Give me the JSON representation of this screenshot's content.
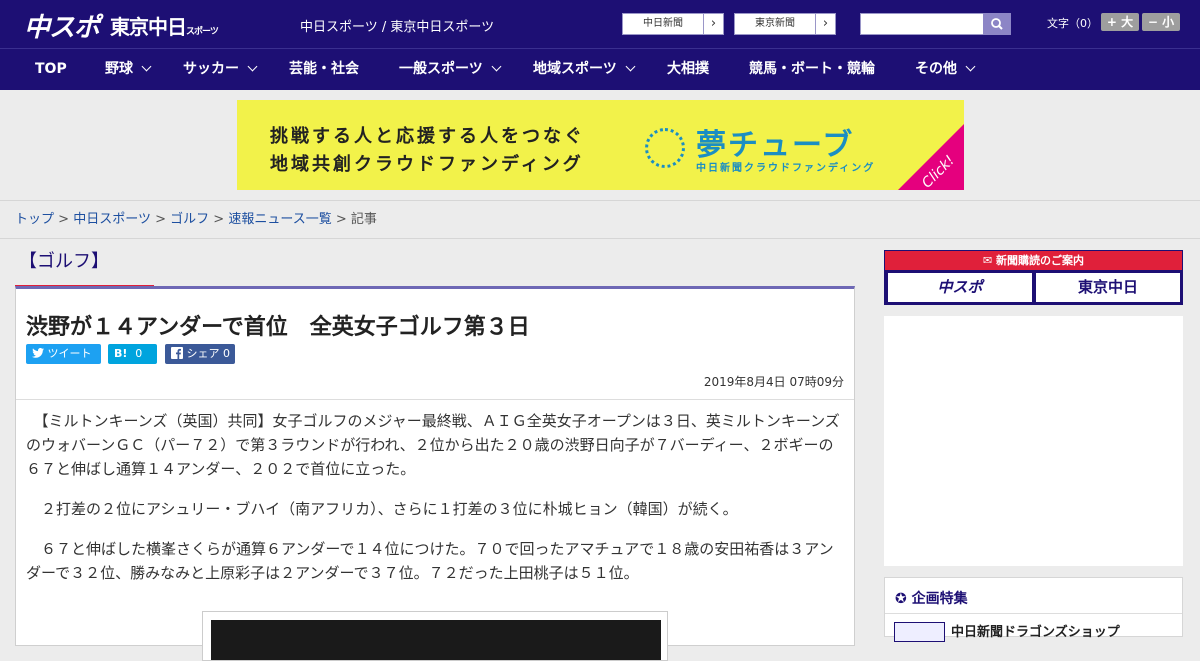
{
  "header": {
    "logo_chunichi": "中スポ",
    "logo_tokyo": "東京中日",
    "logo_tokyo_small": "スポーツ",
    "site_names": "中日スポーツ / 東京中日スポーツ",
    "paper1": "中日新聞",
    "paper2": "東京新聞",
    "search_placeholder": "",
    "font_label": "文字（0）",
    "font_up": "+ 大",
    "font_down": "− 小"
  },
  "nav": [
    "TOP",
    "野球",
    "サッカー",
    "芸能・社会",
    "一般スポーツ",
    "地域スポーツ",
    "大相撲",
    "競馬・ボート・競輪",
    "その他"
  ],
  "banner": {
    "line1": "挑戦する人と応援する人をつなぐ",
    "line2": "地域共創クラウドファンディング",
    "brand": "夢チューブ",
    "brand_sub": "中日新聞クラウドファンディング",
    "click": "Click!"
  },
  "breadcrumb": {
    "items": [
      "トップ",
      "中日スポーツ",
      "ゴルフ",
      "速報ニュース一覧"
    ],
    "current": "記事",
    "sep": ">"
  },
  "article": {
    "category": "【ゴルフ】",
    "title": "渋野が１４アンダーで首位　全英女子ゴルフ第３日",
    "tweet": "ツイート",
    "hatena": "B!",
    "hatena_count": "0",
    "share": "シェア",
    "share_count": "0",
    "date": "2019年8月4日 07時09分",
    "paragraphs": [
      "【ミルトンキーンズ（英国）共同】女子ゴルフのメジャー最終戦、ＡＩＧ全英女子オープンは３日、英ミルトンキーンズのウォバーンＧＣ（パー７２）で第３ラウンドが行われ、２位から出た２０歳の渋野日向子が７バーディー、２ボギーの６７と伸ばし通算１４アンダー、２０２で首位に立った。",
      "２打差の２位にアシュリー・ブハイ（南アフリカ）、さらに１打差の３位に朴城ヒョン（韓国）が続く。",
      "６７と伸ばした横峯さくらが通算６アンダーで１４位につけた。７０で回ったアマチュアで１８歳の安田祐香は３アンダーで３２位、勝みなみと上原彩子は２アンダーで３７位。７２だった上田桃子は５１位。"
    ]
  },
  "sidebar": {
    "subscribe_head": "新聞購読のご案内",
    "sub_logo1": "中スポ",
    "sub_logo2": "東京中日",
    "special_head": "企画特集",
    "special_item": "中日新聞ドラゴンズショップ"
  },
  "colors": {
    "brand_navy": "#1d0f74",
    "accent_red": "#e0203a",
    "twitter": "#1da1f2",
    "hatena": "#00a4de",
    "facebook": "#3b5998"
  }
}
